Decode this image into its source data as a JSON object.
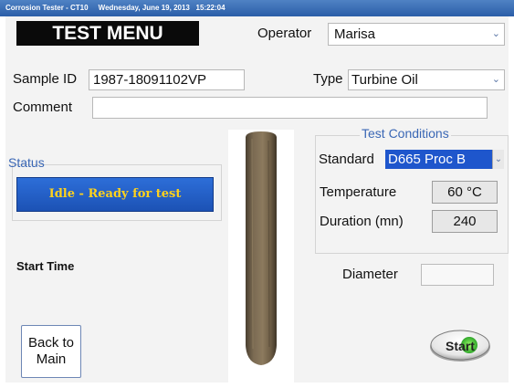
{
  "titlebar": {
    "app": "Corrosion Tester - CT10",
    "date": "Wednesday, June 19, 2013",
    "time": "15:22:04"
  },
  "header": {
    "menu_title": "TEST MENU"
  },
  "operator": {
    "label": "Operator",
    "value": "Marisa"
  },
  "sample": {
    "label": "Sample ID",
    "value": "1987-18091102VP"
  },
  "type": {
    "label": "Type",
    "value": "Turbine Oil"
  },
  "comment": {
    "label": "Comment",
    "value": ""
  },
  "status": {
    "label": "Status",
    "value": "Idle - Ready for test",
    "text_color": "#ffd21c",
    "bg_color": "#1f5bc7"
  },
  "start_time": {
    "label": "Start Time",
    "value": ""
  },
  "back_button": {
    "line1": "Back to",
    "line2": "Main"
  },
  "conditions": {
    "title": "Test Conditions",
    "standard": {
      "label": "Standard",
      "value": "D665 Proc B"
    },
    "temperature": {
      "label": "Temperature",
      "value": "60 °C"
    },
    "duration": {
      "label": "Duration (mn)",
      "value": "240"
    }
  },
  "diameter": {
    "label": "Diameter",
    "value": ""
  },
  "start_button": {
    "label": "Start"
  },
  "icons": {
    "dropdown": "chevron-down-icon",
    "specimen": "test-specimen-image"
  }
}
